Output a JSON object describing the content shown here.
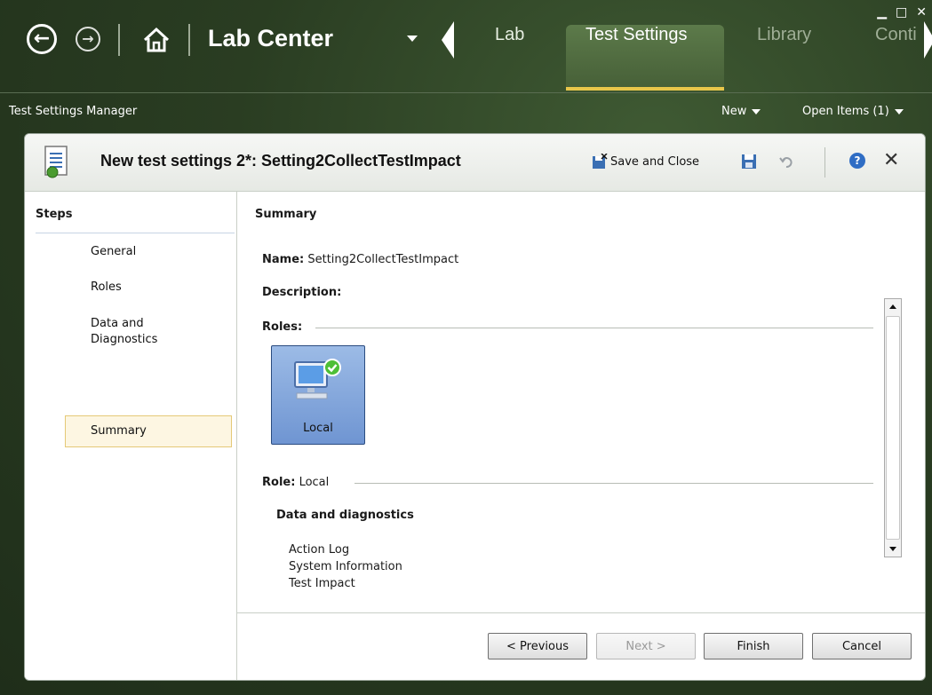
{
  "nav": {
    "app_title": "Lab Center",
    "tabs": [
      {
        "label": "Lab"
      },
      {
        "label": "Test Settings"
      },
      {
        "label": "Library"
      },
      {
        "label": "Conti"
      }
    ]
  },
  "subbar": {
    "manager": "Test Settings Manager",
    "new_label": "New",
    "open_items": "Open Items (1)"
  },
  "panel": {
    "title": "New test settings 2*: Setting2CollectTestImpact",
    "save_close": "Save and Close",
    "help": "?",
    "close": "✕"
  },
  "steps": {
    "heading": "Steps",
    "items": [
      "General",
      "Roles",
      "Data and Diagnostics",
      "Summary"
    ]
  },
  "summary": {
    "heading": "Summary",
    "name_label": "Name:",
    "name_value": "Setting2CollectTestImpact",
    "description_label": "Description:",
    "roles_label": "Roles:",
    "role_tile": "Local",
    "role_label": "Role:",
    "role_value": "Local",
    "dd_heading": "Data and diagnostics",
    "dd_items": [
      "Action Log",
      "System Information",
      "Test Impact"
    ]
  },
  "buttons": {
    "previous": "< Previous",
    "next": "Next >",
    "finish": "Finish",
    "cancel": "Cancel"
  }
}
